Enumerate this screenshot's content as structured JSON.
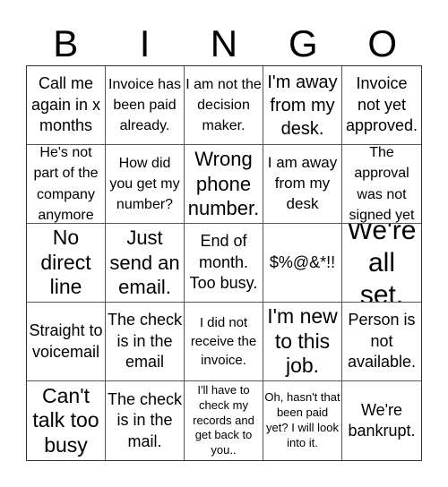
{
  "card": {
    "header_letters": [
      "B",
      "I",
      "N",
      "G",
      "O"
    ],
    "cells": [
      {
        "text": "Call me again in x months"
      },
      {
        "text": "Invoice has been paid already."
      },
      {
        "text": "I am not the decision maker."
      },
      {
        "text": "I'm away from my desk."
      },
      {
        "text": "Invoice not yet approved."
      },
      {
        "text": "He's not part of the company anymore"
      },
      {
        "text": "How did you get my number?"
      },
      {
        "text": "Wrong phone number."
      },
      {
        "text": "I am away from my desk"
      },
      {
        "text": "The approval was not signed yet"
      },
      {
        "text": "No direct line"
      },
      {
        "text": "Just send an email."
      },
      {
        "text": "End of month. Too busy."
      },
      {
        "text": "$%@&*!!"
      },
      {
        "text": "We're all set."
      },
      {
        "text": "Straight to voicemail"
      },
      {
        "text": "The check is in the email"
      },
      {
        "text": "I did not receive the invoice."
      },
      {
        "text": "I'm new to this job."
      },
      {
        "text": "Person is not available."
      },
      {
        "text": "Can't talk too busy"
      },
      {
        "text": "The check is in the mail."
      },
      {
        "text": "I'll have to check my records and get back to you.."
      },
      {
        "text": "Oh, hasn't that been paid yet? I will look into it."
      },
      {
        "text": "We're bankrupt."
      }
    ]
  }
}
